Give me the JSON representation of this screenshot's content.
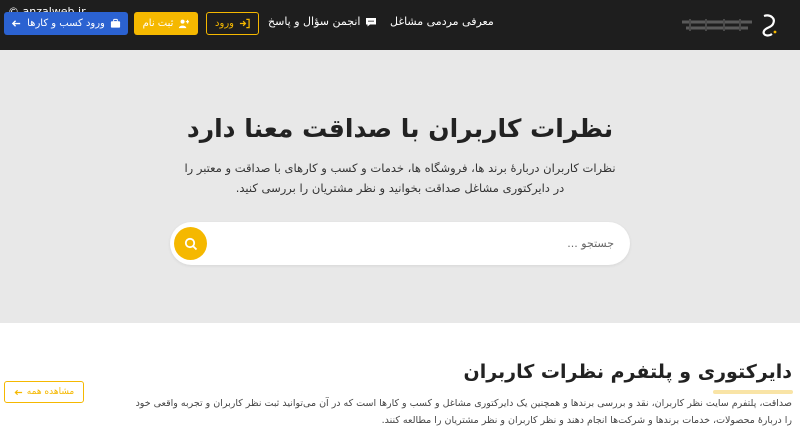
{
  "watermark": "© anzalweb.ir",
  "header": {
    "business_login_label": "ورود کسب و کارها",
    "signup_label": "ثبت نام",
    "login_label": "ورود",
    "nav": {
      "forum_label": "انجمن سؤال و پاسخ",
      "intro_label": "معرفی مردمی مشاغل"
    },
    "colors": {
      "background": "#1e1e1e",
      "primary": "#2b62d1",
      "accent": "#f5b800"
    }
  },
  "hero": {
    "title": "نظرات کاربران با صداقت معنا دارد",
    "description": "نظرات کاربران دربارهٔ برند ها، فروشگاه ها، خدمات و کسب و کارهای با صداقت و معتبر را در دایرکتوری مشاغل صداقت بخوانید و نظر مشتریان را بررسی کنید.",
    "search_placeholder": "جستجو ..."
  },
  "section": {
    "title": "دایرکتوری و پلتفرم نظرات کاربران",
    "description": "صداقت، پلتفرم سایت نظر کاربران، نقد و بررسی برندها و همچنین یک دایرکتوری مشاغل و کسب و کارها است که در آن می‌توانید ثبت نظر کاربران و تجربه واقعی خود را دربارهٔ محصولات، خدمات برندها و شرکت‌ها انجام دهند و نظر کاربران و نظر مشتریان را مطالعه کنند.",
    "view_all_label": "مشاهده همه"
  }
}
